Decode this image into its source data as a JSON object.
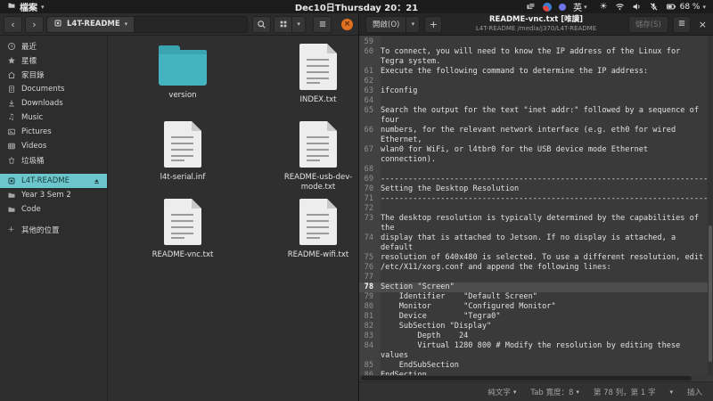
{
  "topbar": {
    "app_menu": "檔案",
    "clock": "Dec10日Thursday 20：21",
    "input_method": "英",
    "battery": "68 %",
    "tray_icons": [
      "window-stack-icon",
      "firefox-icon",
      "input-method-dot-icon",
      "ime-indicator",
      "brightness-icon",
      "wifi-icon",
      "volume-icon",
      "microphone-muted-icon",
      "battery-icon"
    ]
  },
  "files_window": {
    "toolbar": {
      "back": "‹",
      "forward": "›",
      "location": "L4T-README"
    },
    "sidebar": [
      {
        "label": "最近",
        "icon": "recent"
      },
      {
        "label": "星標",
        "icon": "star"
      },
      {
        "label": "家目錄",
        "icon": "home"
      },
      {
        "label": "Documents",
        "icon": "document"
      },
      {
        "label": "Downloads",
        "icon": "download"
      },
      {
        "label": "Music",
        "icon": "music"
      },
      {
        "label": "Pictures",
        "icon": "picture"
      },
      {
        "label": "Videos",
        "icon": "video"
      },
      {
        "label": "垃圾桶",
        "icon": "trash"
      },
      {
        "label": "L4T-README",
        "icon": "drive",
        "selected": true,
        "eject": true,
        "gap": true
      },
      {
        "label": "Year 3 Sem 2",
        "icon": "folder"
      },
      {
        "label": "Code",
        "icon": "folder"
      },
      {
        "label": "其他的位置",
        "icon": "plus",
        "gap": true
      }
    ],
    "files": [
      {
        "name": "version",
        "type": "folder"
      },
      {
        "name": "INDEX.txt",
        "type": "text"
      },
      {
        "name": "l4t-serial.inf",
        "type": "text"
      },
      {
        "name": "README-usb-dev-mode.txt",
        "type": "text"
      },
      {
        "name": "README-vnc.txt",
        "type": "text"
      },
      {
        "name": "README-wifi.txt",
        "type": "text"
      }
    ]
  },
  "editor_window": {
    "header": {
      "open_button": "開啟(O)",
      "new_tab_button": "+",
      "title": "README-vnc.txt [唯讀]",
      "subtitle": "L4T-README /media/j370/L4T-README",
      "save_button": "儲存(S)"
    },
    "lines": [
      {
        "n": "59",
        "t": ""
      },
      {
        "n": "60",
        "t": "To connect, you will need to know the IP address of the Linux for"
      },
      {
        "n": "",
        "t": "Tegra system."
      },
      {
        "n": "61",
        "t": "Execute the following command to determine the IP address:"
      },
      {
        "n": "62",
        "t": ""
      },
      {
        "n": "63",
        "t": "ifconfig"
      },
      {
        "n": "64",
        "t": ""
      },
      {
        "n": "65",
        "t": "Search the output for the text \"inet addr:\" followed by a sequence of"
      },
      {
        "n": "",
        "t": "four"
      },
      {
        "n": "66",
        "t": "numbers, for the relevant network interface (e.g. eth0 for wired"
      },
      {
        "n": "",
        "t": "Ethernet,"
      },
      {
        "n": "67",
        "t": "wlan0 for WiFi, or l4tbr0 for the USB device mode Ethernet"
      },
      {
        "n": "",
        "t": "connection)."
      },
      {
        "n": "68",
        "t": ""
      },
      {
        "n": "69",
        "t": "--------------------------------------------------------------------------------"
      },
      {
        "n": "70",
        "t": "Setting the Desktop Resolution"
      },
      {
        "n": "71",
        "t": "--------------------------------------------------------------------------------"
      },
      {
        "n": "72",
        "t": ""
      },
      {
        "n": "73",
        "t": "The desktop resolution is typically determined by the capabilities of"
      },
      {
        "n": "",
        "t": "the"
      },
      {
        "n": "74",
        "t": "display that is attached to Jetson. If no display is attached, a"
      },
      {
        "n": "",
        "t": "default"
      },
      {
        "n": "75",
        "t": "resolution of 640x480 is selected. To use a different resolution, edit"
      },
      {
        "n": "76",
        "t": "/etc/X11/xorg.conf and append the following lines:"
      },
      {
        "n": "77",
        "t": ""
      },
      {
        "n": "78",
        "t": "Section \"Screen\"",
        "hl": true
      },
      {
        "n": "79",
        "t": "    Identifier    \"Default Screen\""
      },
      {
        "n": "80",
        "t": "    Monitor       \"Configured Monitor\""
      },
      {
        "n": "81",
        "t": "    Device        \"Tegra0\""
      },
      {
        "n": "82",
        "t": "    SubSection \"Display\""
      },
      {
        "n": "83",
        "t": "        Depth    24"
      },
      {
        "n": "84",
        "t": "        Virtual 1280 800 # Modify the resolution by editing these"
      },
      {
        "n": "",
        "t": "values"
      },
      {
        "n": "85",
        "t": "    EndSubSection"
      },
      {
        "n": "86",
        "t": "EndSection"
      }
    ],
    "statusbar": {
      "language": "純文字",
      "tab_width": "Tab 寬度：8",
      "position": "第 78 列，第 1 字",
      "mode": "插入"
    }
  }
}
